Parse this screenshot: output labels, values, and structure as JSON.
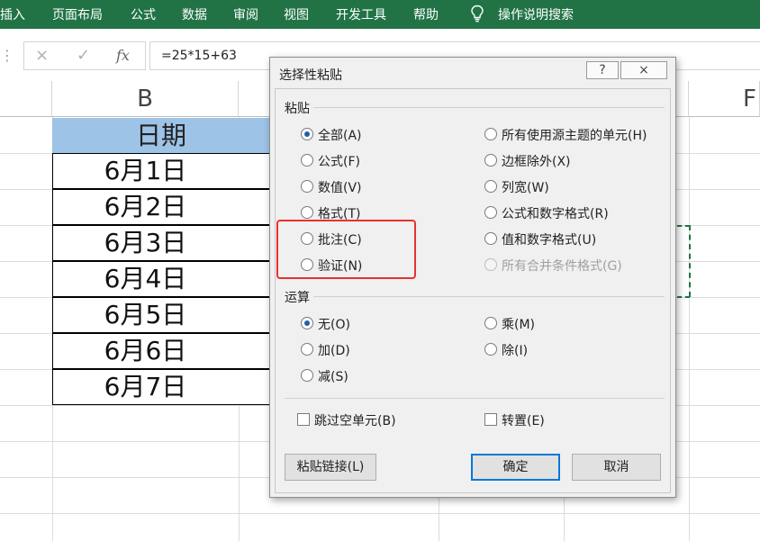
{
  "ribbon": {
    "tabs": [
      "插入",
      "页面布局",
      "公式",
      "数据",
      "审阅",
      "视图",
      "开发工具",
      "帮助"
    ],
    "tell_me": "操作说明搜索",
    "color": "#217346"
  },
  "formula_bar": {
    "cancel_icon": "×",
    "enter_icon": "✓",
    "fx_icon": "fx",
    "formula": "=25*15+63"
  },
  "sheet": {
    "col_b": "B",
    "col_f": "F",
    "header": "日期",
    "header_fill": "#9dc3e6",
    "dates": [
      "6月1日",
      "6月2日",
      "6月3日",
      "6月4日",
      "6月5日",
      "6月6日",
      "6月7日"
    ]
  },
  "dialog": {
    "title": "选择性粘贴",
    "help_icon": "?",
    "close_icon": "×",
    "paste_group": "粘贴",
    "paste_left": [
      {
        "label": "全部(A)",
        "selected": true
      },
      {
        "label": "公式(F)",
        "selected": false
      },
      {
        "label": "数值(V)",
        "selected": false
      },
      {
        "label": "格式(T)",
        "selected": false
      },
      {
        "label": "批注(C)",
        "selected": false
      },
      {
        "label": "验证(N)",
        "selected": false
      }
    ],
    "paste_right": [
      {
        "label": "所有使用源主题的单元(H)",
        "selected": false,
        "disabled": false
      },
      {
        "label": "边框除外(X)",
        "selected": false,
        "disabled": false
      },
      {
        "label": "列宽(W)",
        "selected": false,
        "disabled": false
      },
      {
        "label": "公式和数字格式(R)",
        "selected": false,
        "disabled": false
      },
      {
        "label": "值和数字格式(U)",
        "selected": false,
        "disabled": false
      },
      {
        "label": "所有合并条件格式(G)",
        "selected": false,
        "disabled": true
      }
    ],
    "operation_group": "运算",
    "op_left": [
      {
        "label": "无(O)",
        "selected": true
      },
      {
        "label": "加(D)",
        "selected": false
      },
      {
        "label": "减(S)",
        "selected": false
      }
    ],
    "op_right": [
      {
        "label": "乘(M)",
        "selected": false
      },
      {
        "label": "除(I)",
        "selected": false
      }
    ],
    "skip_blanks": "跳过空单元(B)",
    "transpose": "转置(E)",
    "paste_link": "粘贴链接(L)",
    "ok": "确定",
    "cancel": "取消",
    "highlight_color": "#e8322c"
  }
}
